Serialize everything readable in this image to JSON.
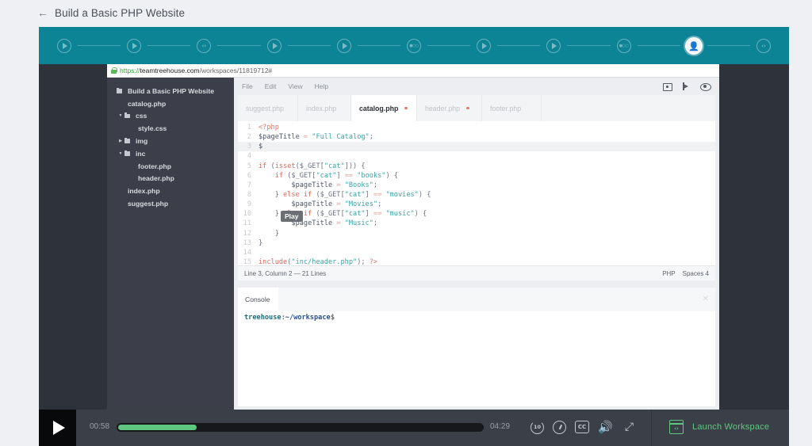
{
  "page": {
    "back_icon": "arrow-left-icon",
    "course_title": "Build a Basic PHP Website"
  },
  "stages": [
    {
      "type": "video",
      "icon": "play-circle-icon",
      "glyph": "▶"
    },
    {
      "type": "video",
      "icon": "play-circle-icon",
      "glyph": "▶"
    },
    {
      "type": "code",
      "icon": "code-circle-icon",
      "glyph": "‹›"
    },
    {
      "type": "video",
      "icon": "play-circle-icon",
      "glyph": "▶"
    },
    {
      "type": "video",
      "icon": "play-circle-icon",
      "glyph": "▶"
    },
    {
      "type": "quiz",
      "icon": "quiz-circle-icon",
      "glyph": "●○○"
    },
    {
      "type": "video",
      "icon": "play-circle-icon",
      "glyph": "▶"
    },
    {
      "type": "video",
      "icon": "play-circle-icon",
      "glyph": "▶"
    },
    {
      "type": "quiz",
      "icon": "quiz-circle-icon",
      "glyph": "●○○"
    },
    {
      "type": "current",
      "icon": "user-avatar-icon",
      "glyph": "👤"
    },
    {
      "type": "code",
      "icon": "code-circle-icon",
      "glyph": "‹›"
    }
  ],
  "browser": {
    "url_scheme": "https://",
    "url_host": "teamtreehouse.com",
    "url_path": "/workspaces/11819712#"
  },
  "file_tree": [
    {
      "label": "Build a Basic PHP Website",
      "type": "folder",
      "caret": "",
      "depth": 0
    },
    {
      "label": "catalog.php",
      "type": "file",
      "depth": 1
    },
    {
      "label": "css",
      "type": "folder",
      "caret": "▼",
      "depth": 0
    },
    {
      "label": "style.css",
      "type": "file",
      "depth": 2
    },
    {
      "label": "img",
      "type": "folder",
      "caret": "▶",
      "depth": 0
    },
    {
      "label": "inc",
      "type": "folder",
      "caret": "▼",
      "depth": 0
    },
    {
      "label": "footer.php",
      "type": "file",
      "depth": 2
    },
    {
      "label": "header.php",
      "type": "file",
      "depth": 2
    },
    {
      "label": "index.php",
      "type": "file",
      "depth": 1
    },
    {
      "label": "suggest.php",
      "type": "file",
      "depth": 1
    }
  ],
  "editor": {
    "menu": [
      "File",
      "Edit",
      "View",
      "Help"
    ],
    "toolbar_icons": [
      "camera-icon",
      "share-icon",
      "eye-icon"
    ],
    "tabs": [
      {
        "label": "suggest.php",
        "active": false,
        "dirty": false
      },
      {
        "label": "index.php",
        "active": false,
        "dirty": false
      },
      {
        "label": "catalog.php",
        "active": true,
        "dirty": true
      },
      {
        "label": "header.php",
        "active": false,
        "dirty": true
      },
      {
        "label": "footer.php",
        "active": false,
        "dirty": false
      }
    ],
    "current_line": 3,
    "code_lines": [
      [
        [
          "tag",
          "<?php"
        ]
      ],
      [
        [
          "var",
          "$pageTitle"
        ],
        [
          "op",
          " = "
        ],
        [
          "str",
          "\"Full Catalog\""
        ],
        [
          "plain",
          ";"
        ]
      ],
      [
        [
          "var",
          "$"
        ]
      ],
      [],
      [
        [
          "kw",
          "if"
        ],
        [
          "plain",
          " ("
        ],
        [
          "fn",
          "isset"
        ],
        [
          "plain",
          "($_GET["
        ],
        [
          "str",
          "\"cat\""
        ],
        [
          "plain",
          "])) {"
        ]
      ],
      [
        [
          "plain",
          "    "
        ],
        [
          "kw",
          "if"
        ],
        [
          "plain",
          " ($_GET["
        ],
        [
          "str",
          "\"cat\""
        ],
        [
          "plain",
          "] "
        ],
        [
          "op",
          "=="
        ],
        [
          "plain",
          " "
        ],
        [
          "str",
          "\"books\""
        ],
        [
          "plain",
          ") {"
        ]
      ],
      [
        [
          "plain",
          "        "
        ],
        [
          "var",
          "$pageTitle"
        ],
        [
          "op",
          " = "
        ],
        [
          "str",
          "\"Books\""
        ],
        [
          "plain",
          ";"
        ]
      ],
      [
        [
          "plain",
          "    } "
        ],
        [
          "kw",
          "else if"
        ],
        [
          "plain",
          " ($_GET["
        ],
        [
          "str",
          "\"cat\""
        ],
        [
          "plain",
          "] "
        ],
        [
          "op",
          "=="
        ],
        [
          "plain",
          " "
        ],
        [
          "str",
          "\"movies\""
        ],
        [
          "plain",
          ") {"
        ]
      ],
      [
        [
          "plain",
          "        "
        ],
        [
          "var",
          "$pageTitle"
        ],
        [
          "op",
          " = "
        ],
        [
          "str",
          "\"Movies\""
        ],
        [
          "plain",
          ";"
        ]
      ],
      [
        [
          "plain",
          "    } "
        ],
        [
          "kw",
          "else if"
        ],
        [
          "plain",
          " ($_GET["
        ],
        [
          "str",
          "\"cat\""
        ],
        [
          "plain",
          "] "
        ],
        [
          "op",
          "=="
        ],
        [
          "plain",
          " "
        ],
        [
          "str",
          "\"music\""
        ],
        [
          "plain",
          ") {"
        ]
      ],
      [
        [
          "plain",
          "        "
        ],
        [
          "var",
          "$pageTitle"
        ],
        [
          "op",
          " = "
        ],
        [
          "str",
          "\"Music\""
        ],
        [
          "plain",
          ";"
        ]
      ],
      [
        [
          "plain",
          "    }"
        ]
      ],
      [
        [
          "plain",
          "}"
        ]
      ],
      [],
      [
        [
          "fn",
          "include"
        ],
        [
          "plain",
          "("
        ],
        [
          "str",
          "\"inc/header.php\""
        ],
        [
          "plain",
          "); "
        ],
        [
          "tag",
          "?>"
        ]
      ]
    ],
    "status_left": "Line 3, Column 2 — 21 Lines",
    "status_language": "PHP",
    "status_indent": "Spaces 4"
  },
  "tooltip": {
    "text": "Play"
  },
  "console": {
    "tab_label": "Console",
    "close_glyph": "✕",
    "prompt_user": "treehouse",
    "prompt_sep": ":",
    "prompt_path": "~/workspace",
    "prompt_sign": "$"
  },
  "player": {
    "elapsed": "00:58",
    "total": "04:29",
    "progress_fraction": 0.2156,
    "rewind_label": "10",
    "cc_label": "CC",
    "volume_glyph": "🔊",
    "fullscreen_glyph": "⤢",
    "launch_label": "Launch Workspace",
    "launch_icon_glyph": "‹›",
    "accent_color": "#5ec77f",
    "stagebar_color": "#0d8396"
  }
}
